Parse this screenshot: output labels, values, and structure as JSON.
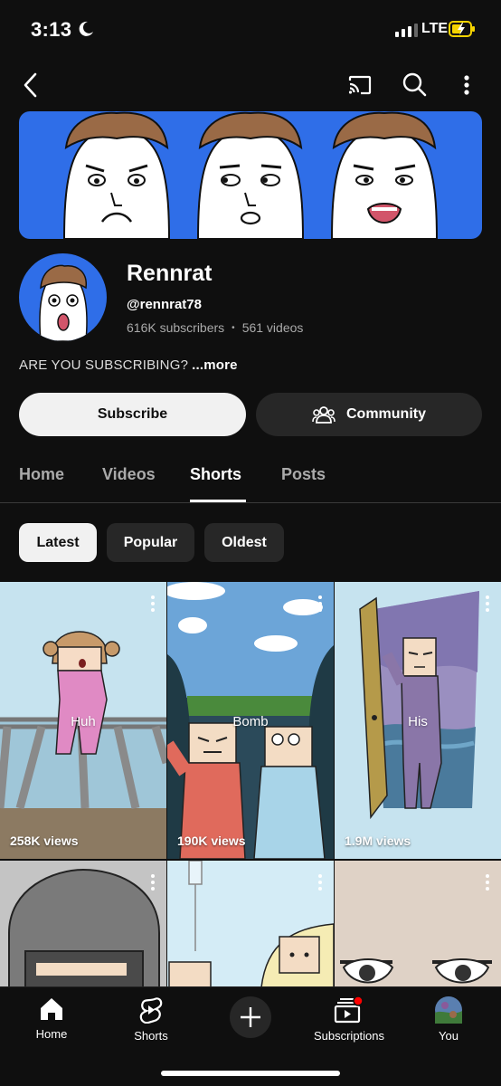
{
  "status_bar": {
    "time": "3:13",
    "network": "LTE"
  },
  "channel": {
    "name": "Rennrat",
    "handle": "@rennrat78",
    "subscribers": "616K subscribers",
    "videos": "561 videos",
    "description": "ARE YOU SUBSCRIBING?",
    "more_label": "...more"
  },
  "actions": {
    "subscribe": "Subscribe",
    "community": "Community"
  },
  "tabs": [
    "Home",
    "Videos",
    "Shorts",
    "Posts"
  ],
  "active_tab": "Shorts",
  "chips": [
    "Latest",
    "Popular",
    "Oldest"
  ],
  "active_chip": "Latest",
  "shorts": [
    {
      "title": "Huh",
      "views": "258K views"
    },
    {
      "title": "Bomb",
      "views": "190K views"
    },
    {
      "title": "His",
      "views": "1.9M views"
    },
    {
      "title": "",
      "views": ""
    },
    {
      "title": "",
      "views": ""
    },
    {
      "title": "",
      "views": ""
    }
  ],
  "bottom_nav": [
    "Home",
    "Shorts",
    "Subscriptions",
    "You"
  ],
  "colors": {
    "background": "#0f0f0f",
    "banner": "#2f6ee8",
    "notification": "#ff0000",
    "battery": "#f5d300"
  }
}
